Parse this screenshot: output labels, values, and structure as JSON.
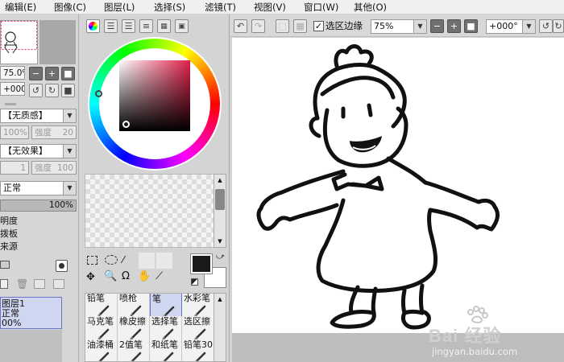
{
  "menu": [
    "编辑(E)",
    "图像(C)",
    "图层(L)",
    "选择(S)",
    "滤镜(T)",
    "视图(V)",
    "窗口(W)",
    "其他(O)"
  ],
  "nav": {
    "zoom": "75.0%",
    "rotation": "+000"
  },
  "brush_settings": {
    "texture": "【无质感】",
    "texture_percent": "100%",
    "texture_strength_label": "强度",
    "texture_strength_value": "20",
    "effect": "【无效果】",
    "effect_value": "1",
    "effect_strength_label": "强度",
    "effect_strength_value": "100"
  },
  "layer": {
    "blend_mode": "正常",
    "opacity": "100%",
    "options": [
      "明度",
      "拨板",
      "来源"
    ],
    "item": {
      "name": "图层1",
      "mode": "正常",
      "opacity": "00%"
    }
  },
  "canvas_toolbar": {
    "selection_edge_label": "选区边缘",
    "selection_edge_checked": true,
    "zoom": "75%",
    "rotation": "+000°"
  },
  "tools": [
    [
      "铅笔",
      "喷枪",
      "笔",
      "水彩笔"
    ],
    [
      "马克笔",
      "橡皮擦",
      "选择笔",
      "选区擦"
    ],
    [
      "油漆桶",
      "2值笔",
      "和纸笔",
      "铅笔30"
    ]
  ],
  "selected_tool": "笔",
  "colors": {
    "primary": "#1a1a1a",
    "secondary": "#ffffff",
    "selection": "#cfd6f0"
  },
  "watermark": {
    "brand": "Bai 经验",
    "url": "jingyan.baidu.com"
  }
}
